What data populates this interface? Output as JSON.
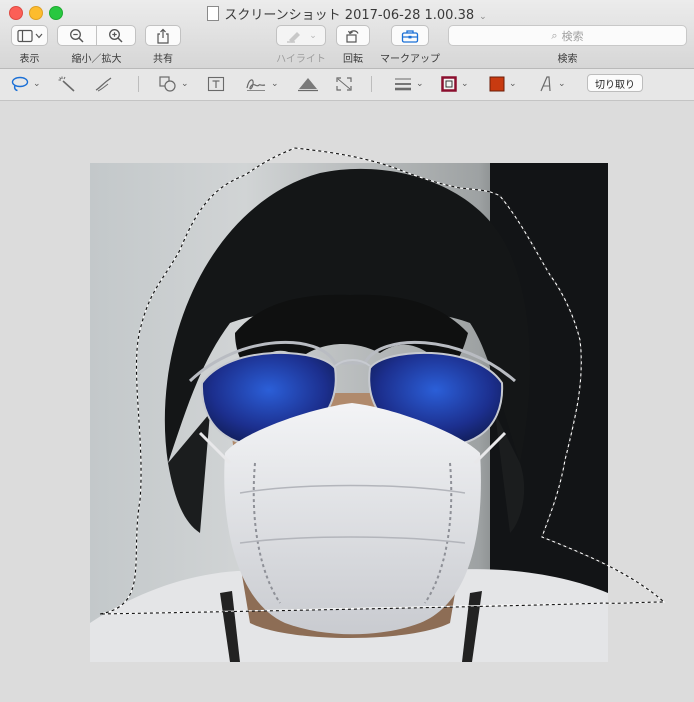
{
  "window": {
    "title": "スクリーンショット 2017-06-28 1.00.38"
  },
  "toolbar": {
    "view_label": "表示",
    "zoom_label": "縮小／拡大",
    "share_label": "共有",
    "highlight_label": "ハイライト",
    "rotate_label": "回転",
    "markup_label": "マークアップ",
    "search_label": "検索",
    "search_placeholder": "検索"
  },
  "markup_bar": {
    "crop_label": "切り取り",
    "border_color": "#8b0f2e",
    "fill_color": "#c83a10"
  }
}
